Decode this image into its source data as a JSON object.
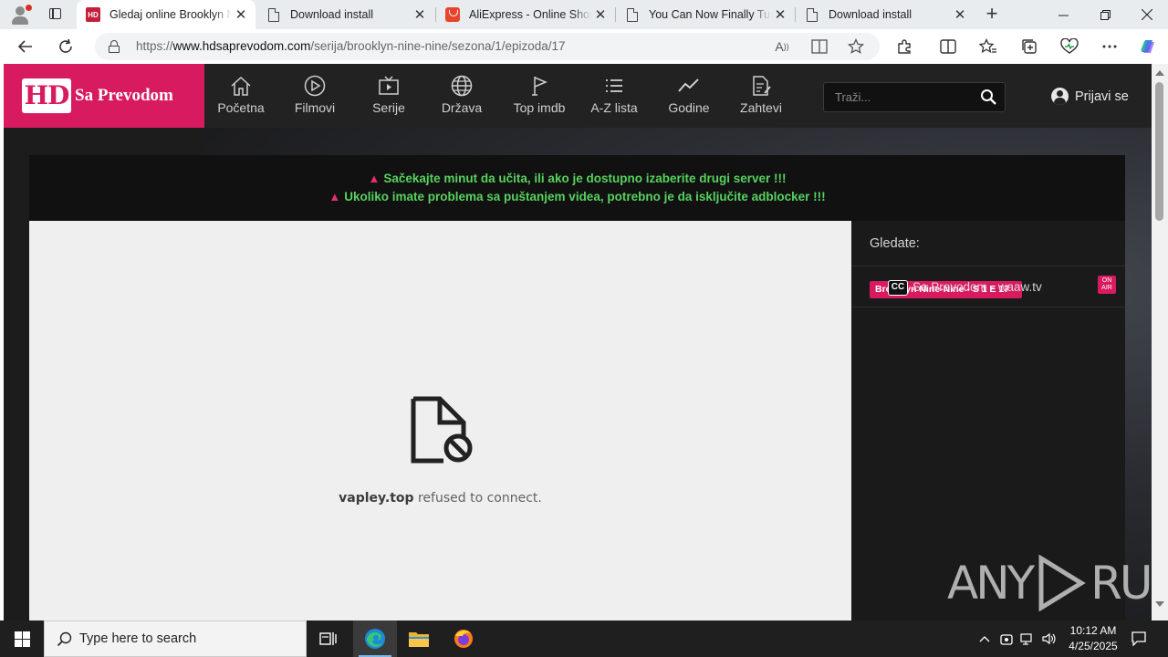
{
  "browser": {
    "tabs": [
      {
        "title": "Gledaj online Brooklyn Nine-Nine",
        "favicon": "hd-sa-prevodom-icon",
        "active": true
      },
      {
        "title": "Download install",
        "favicon": "document-icon",
        "active": false
      },
      {
        "title": "AliExpress - Online Shopping",
        "favicon": "aliexpress-icon",
        "active": false
      },
      {
        "title": "You Can Now Finally Turn",
        "favicon": "document-icon",
        "active": false
      },
      {
        "title": "Download install",
        "favicon": "document-icon",
        "active": false
      }
    ],
    "url_prefix": "https://",
    "url_host": "www.hdsaprevodom.com",
    "url_path": "/serija/brooklyn-nine-nine/sezona/1/epizoda/17"
  },
  "site": {
    "logo_hd": "HD",
    "logo_text": "Sa Prevodom",
    "nav": [
      {
        "label": "Početna",
        "icon": "home-icon"
      },
      {
        "label": "Filmovi",
        "icon": "play-circle-icon"
      },
      {
        "label": "Serije",
        "icon": "tv-icon"
      },
      {
        "label": "Država",
        "icon": "globe-icon"
      },
      {
        "label": "Top imdb",
        "icon": "flag-icon"
      },
      {
        "label": "A-Z lista",
        "icon": "list-icon"
      },
      {
        "label": "Godine",
        "icon": "trend-icon"
      },
      {
        "label": "Zahtevi",
        "icon": "file-edit-icon"
      }
    ],
    "search_placeholder": "Traži...",
    "login_label": "Prijavi se"
  },
  "notice": {
    "line1": "Sačekajte minut da učita, ili ako je dostupno izaberite drugi server !!!",
    "line2": "Ukoliko imate problema sa puštanjem videa, potrebno je da isključite adblocker !!!"
  },
  "player": {
    "error_host": "vapley.top",
    "error_text": "refused to connect."
  },
  "sidebar": {
    "heading": "Gledate:",
    "now_playing": "Brooklyn Nine-Nine - S 1 E 17",
    "cc_label": "CC",
    "server_name": "Sa Prevodom - waaw.tv",
    "onair_line1": "ON",
    "onair_line2": "AIR"
  },
  "watermark": {
    "left": "ANY",
    "right": "RUN"
  },
  "taskbar": {
    "search_placeholder": "Type here to search",
    "time": "10:12 AM",
    "date": "4/25/2025"
  },
  "colors": {
    "brand_pink": "#d81b60",
    "notice_green": "#57d25e",
    "header_bg": "#222222"
  }
}
